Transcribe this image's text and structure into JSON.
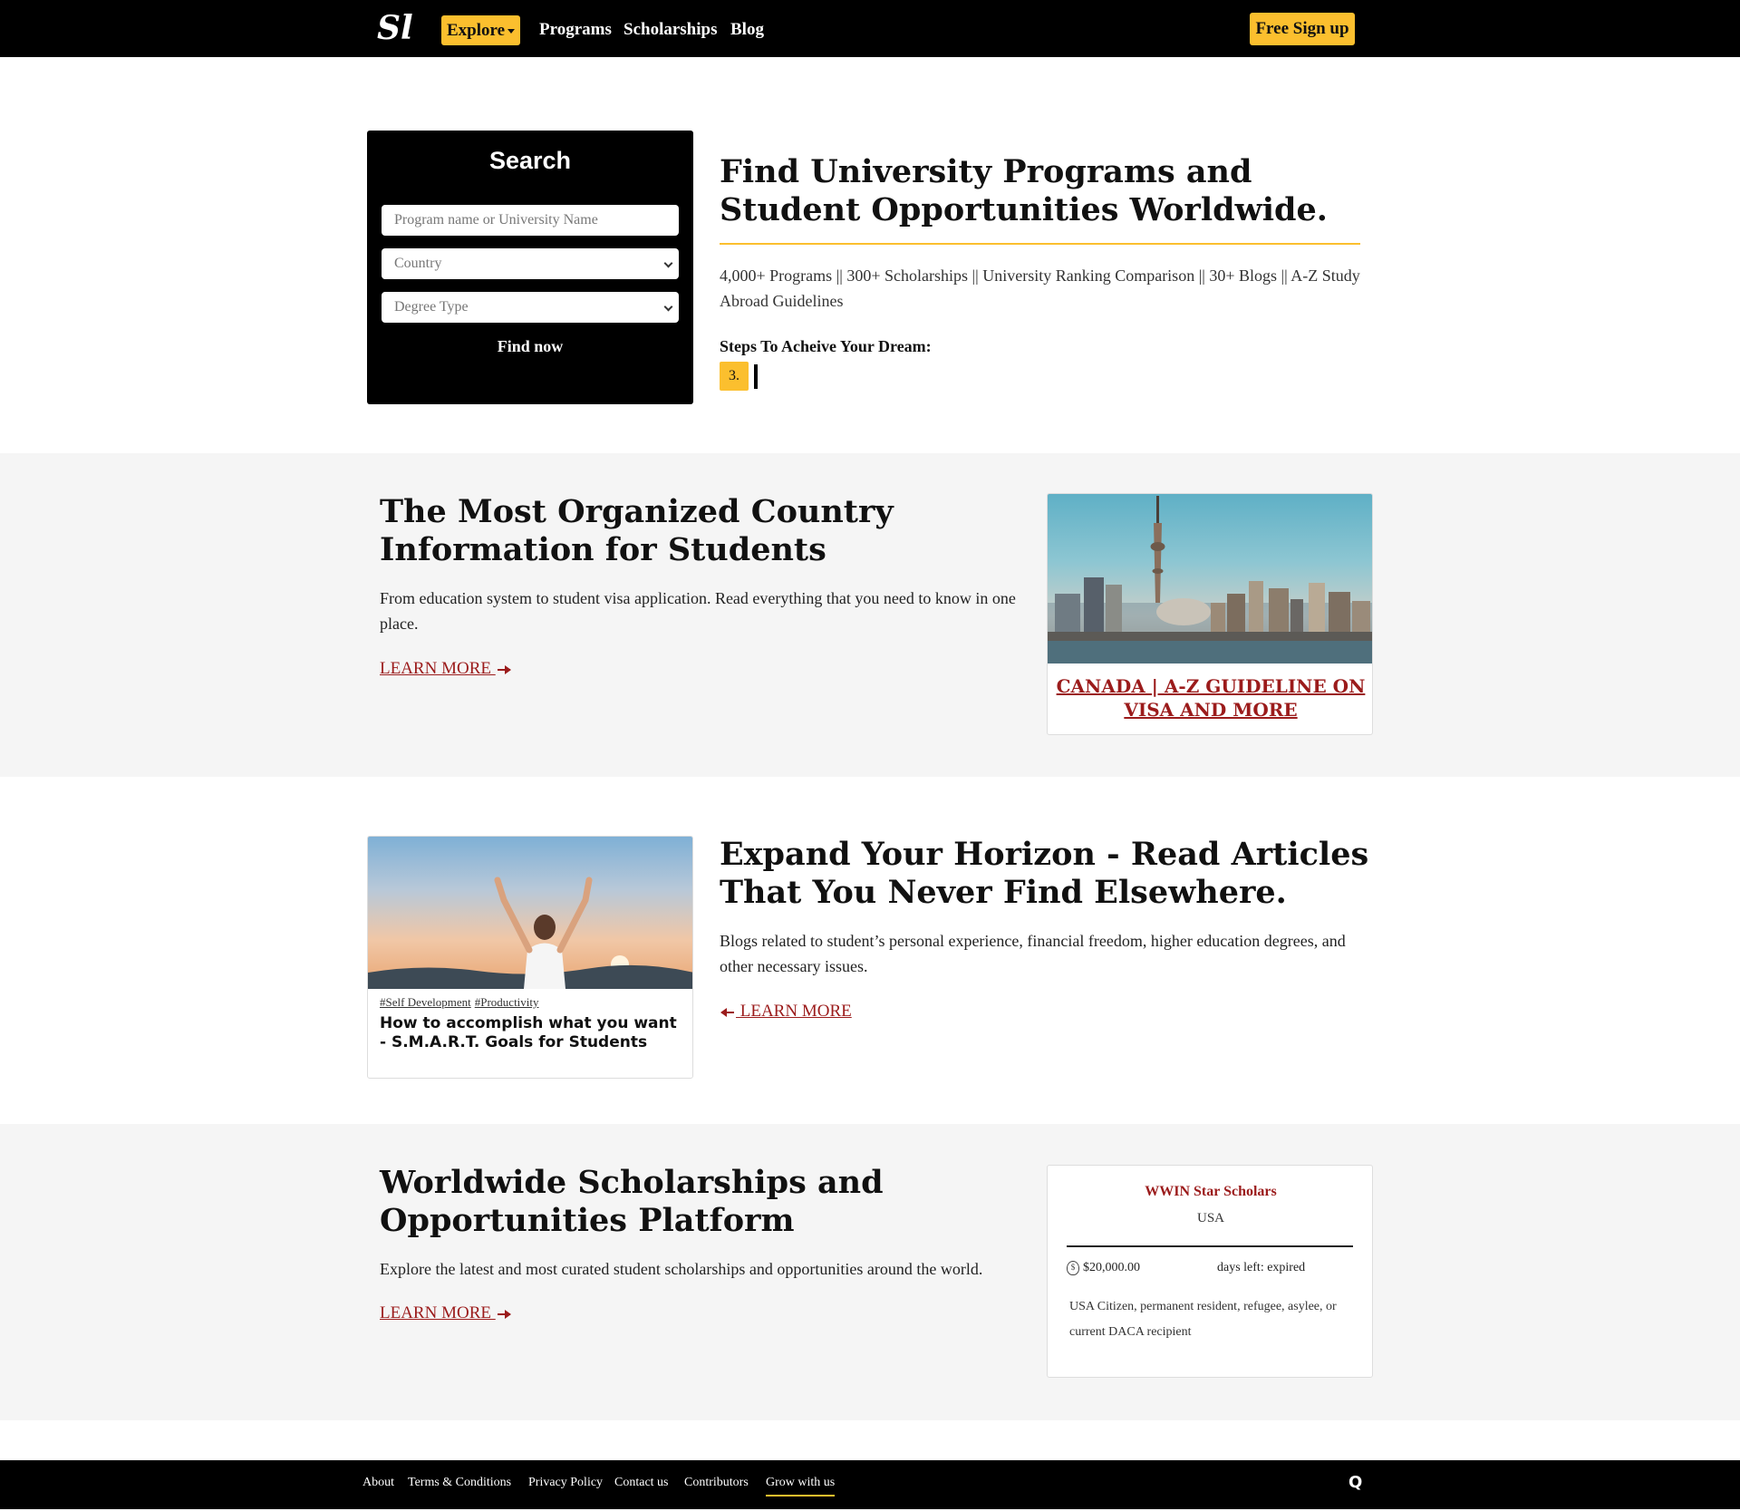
{
  "navbar": {
    "logo": "Sl",
    "explore_label": "Explore",
    "links": [
      "Programs",
      "Scholarships",
      "Blog"
    ],
    "signup_label": "Free Sign up"
  },
  "search": {
    "title": "Search",
    "program_placeholder": "Program name or University Name",
    "country_label": "Country",
    "degree_label": "Degree Type",
    "submit_label": "Find now"
  },
  "hero": {
    "title": "Find University Programs and Student Opportunities Worldwide.",
    "subtitle": "4,000+ Programs || 300+ Scholarships || University Ranking Comparison || 30+ Blogs || A-Z Study Abroad Guidelines",
    "steps_label": "Steps To Acheive Your Dream:",
    "step_badge": "3."
  },
  "country_section": {
    "title": "The Most Organized Country Information for Students",
    "text": "From education system to student visa application. Read everything that you need to know in one place.",
    "learn_more": "LEARN MORE ",
    "card_caption": "CANADA | A-Z GUIDELINE ON VISA AND MORE"
  },
  "blog_section": {
    "title": "Expand Your Horizon - Read Articles That You Never Find Elsewhere.",
    "text": "Blogs related to student’s personal experience, financial freedom, higher education degrees, and other necessary issues.",
    "learn_more": " LEARN MORE",
    "card": {
      "tags": [
        "#Self Development",
        "#Productivity"
      ],
      "title": "How to accomplish what you want - S.M.A.R.T. Goals for Students"
    }
  },
  "scholarship_section": {
    "title": "Worldwide Scholarships and Opportunities Platform",
    "text": "Explore the latest and most curated student scholarships and opportunities around the world.",
    "learn_more": "LEARN MORE ",
    "card": {
      "name": "WWIN Star Scholars",
      "country": "USA",
      "amount": "$20,000.00",
      "days_left": "days left: expired",
      "eligibility": "USA Citizen, permanent resident, refugee, asylee, or current DACA recipient"
    }
  },
  "footer": {
    "links": [
      "About",
      "Terms & Conditions",
      "Privacy Policy",
      "Contact us",
      "Contributors",
      "Grow with us"
    ],
    "icon": "Q"
  },
  "colors": {
    "accent": "#fbbf2e",
    "link": "#9b1b1b",
    "band": "#f5f5f5",
    "dark": "#000000"
  }
}
